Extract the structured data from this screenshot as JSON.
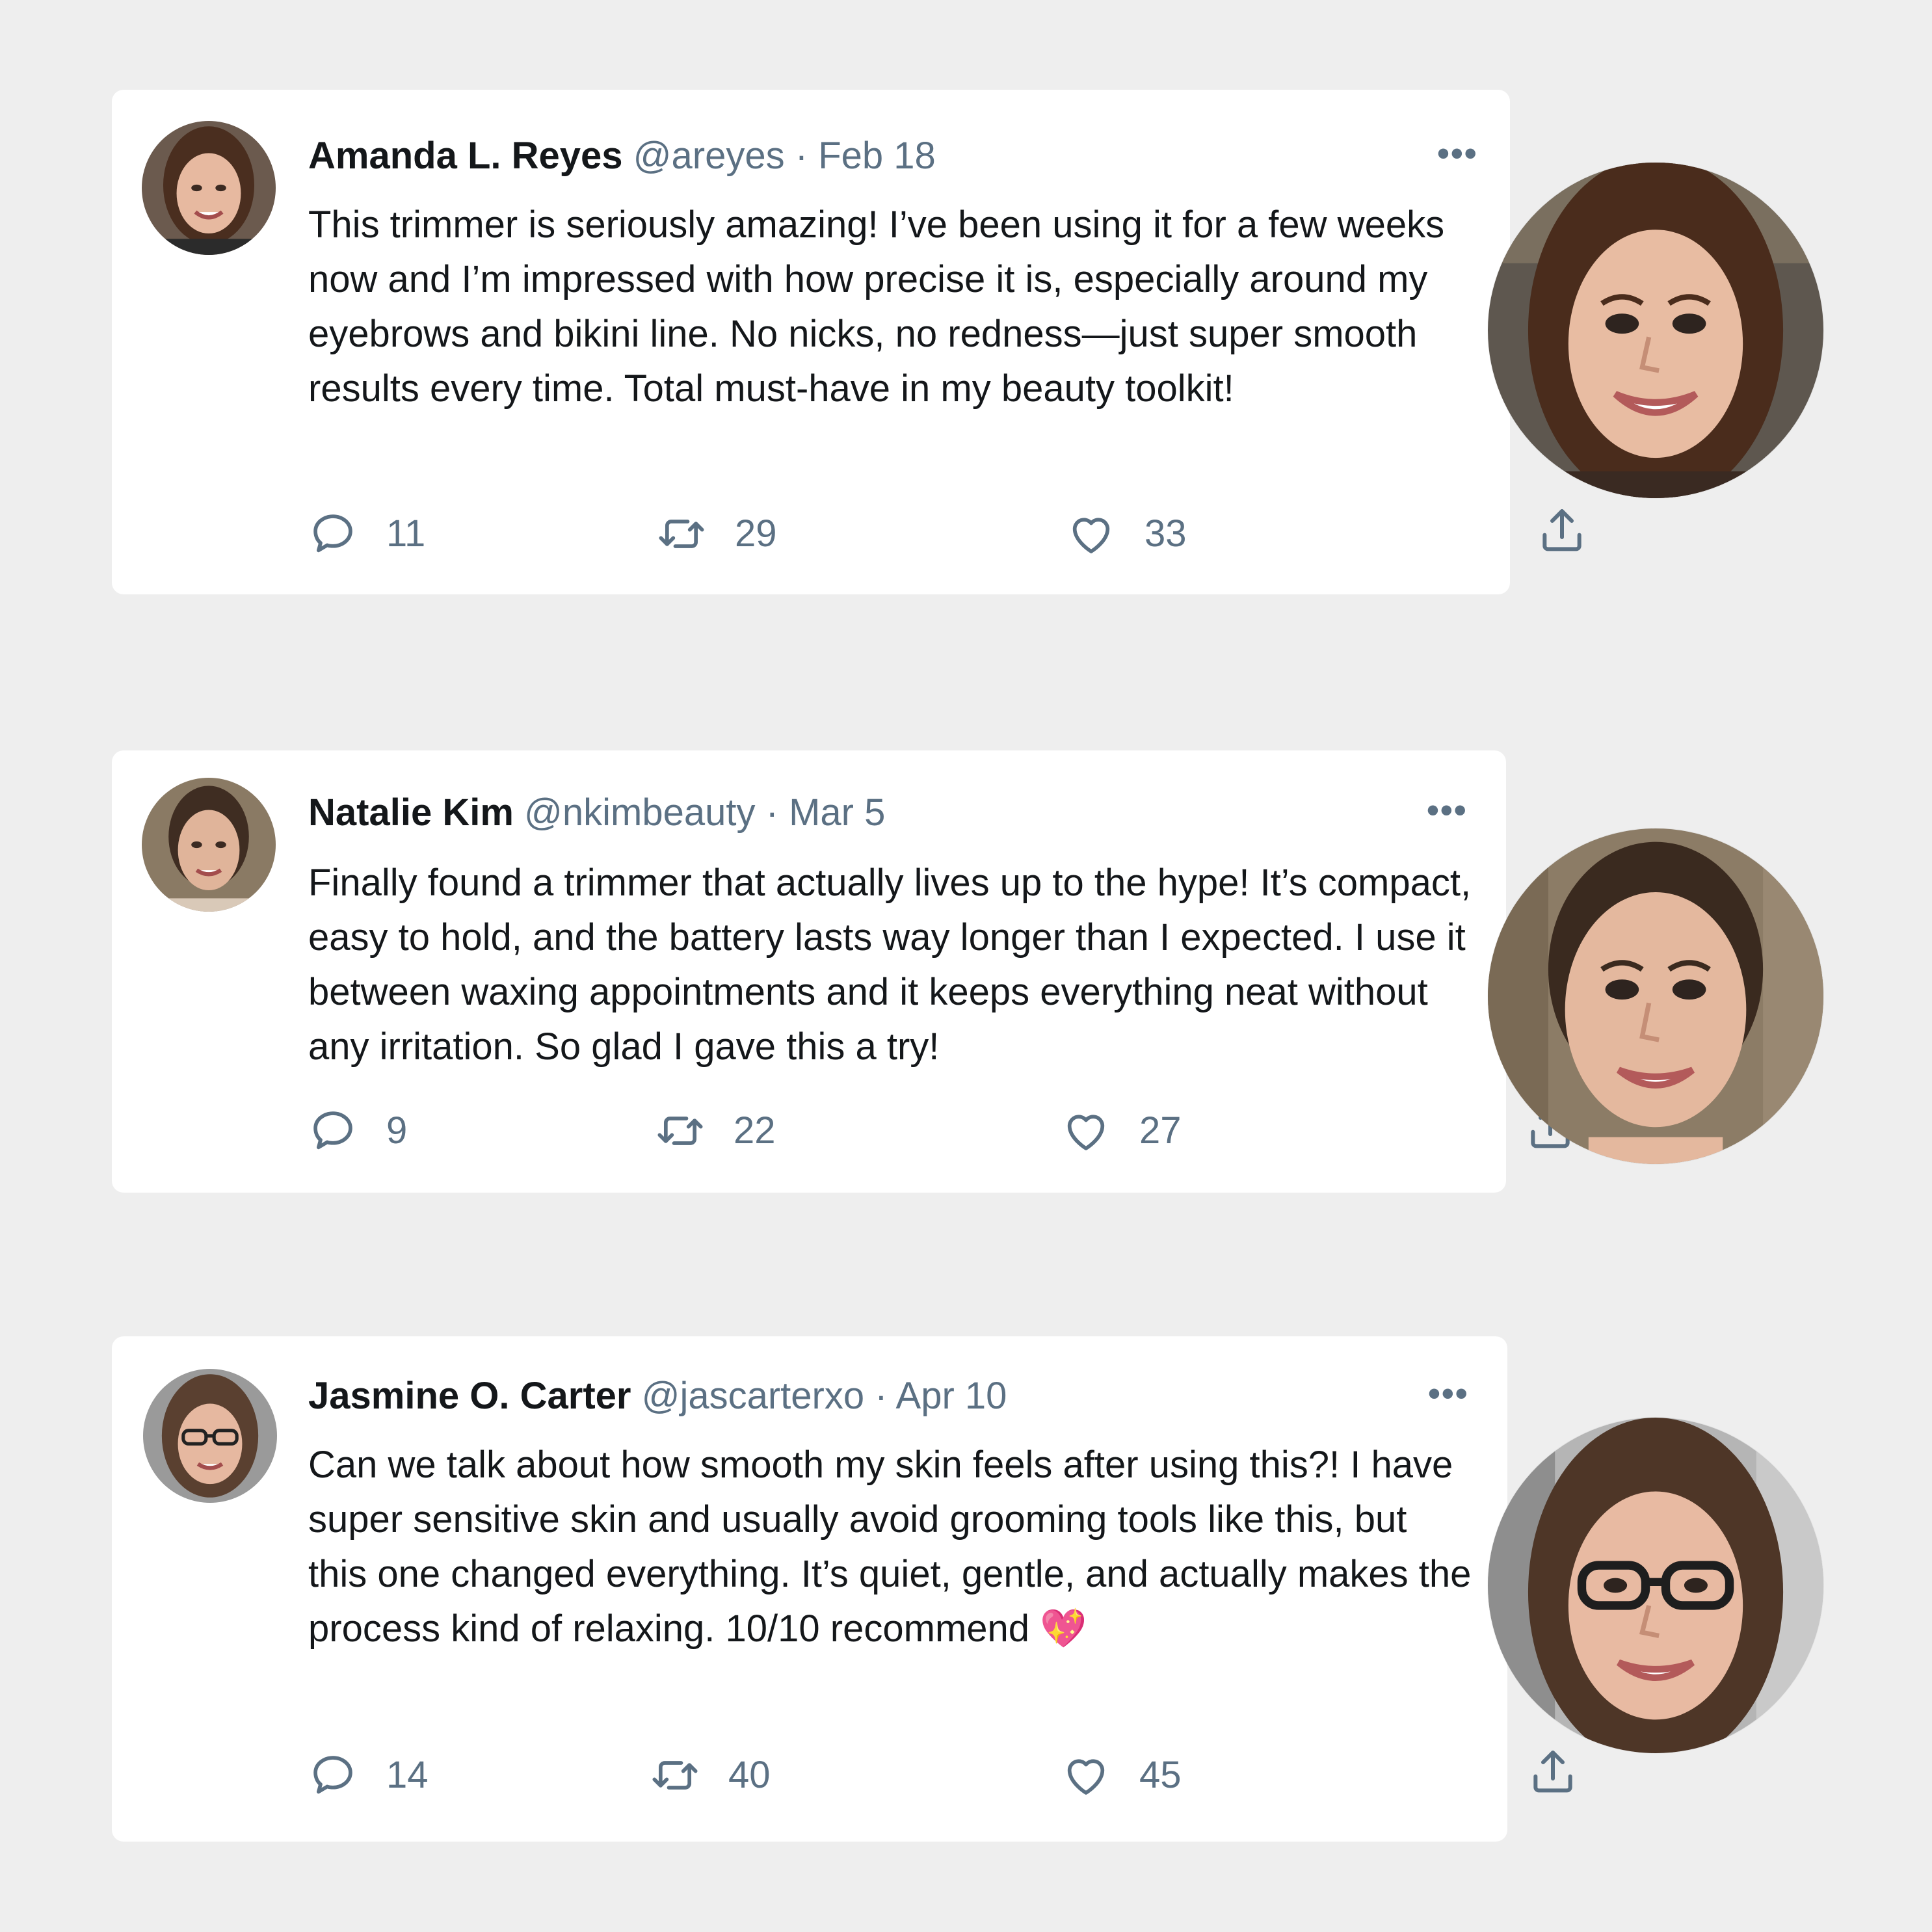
{
  "tweets": [
    {
      "name": "Amanda L. Reyes",
      "handle": "@areyes",
      "separator": "·",
      "date": "Feb 18",
      "more_icon": "more-horizontal-icon",
      "text": "This trimmer is seriously amazing! I’ve been using it for a few weeks now and I’m impressed with how precise it is, especially around my eyebrows and bikini line. No nicks, no redness—just super smooth results every time. Total must-have in my beauty toolkit!",
      "replies": "11",
      "retweets": "29",
      "likes": "33"
    },
    {
      "name": "Natalie Kim",
      "handle": "@nkimbeauty",
      "separator": "·",
      "date": "Mar 5",
      "more_icon": "more-horizontal-icon",
      "text": "Finally found a trimmer that actually lives up to the hype! It’s compact, easy to hold, and the battery lasts way longer than I expected. I use it between waxing appointments and it keeps everything neat without any irritation. So glad I gave this a try!",
      "replies": "9",
      "retweets": "22",
      "likes": "27"
    },
    {
      "name": "Jasmine O. Carter",
      "handle": "@jascarterxo",
      "separator": "·",
      "date": "Apr 10",
      "more_icon": "more-horizontal-icon",
      "text": "Can we talk about how smooth my skin feels after using this?! I have super sensitive skin and usually avoid grooming tools like this, but this one changed everything. It’s quiet, gentle, and actually makes the process kind of relaxing. 10/10 recommend 💖",
      "replies": "14",
      "retweets": "40",
      "likes": "45"
    }
  ],
  "icons": {
    "reply": "reply-icon",
    "retweet": "retweet-icon",
    "like": "heart-icon",
    "share": "share-icon"
  },
  "colors": {
    "background": "#eeeeee",
    "card": "#ffffff",
    "text": "#14171a",
    "muted": "#5b7083"
  }
}
